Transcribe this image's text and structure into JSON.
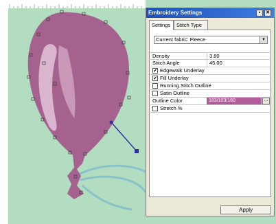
{
  "panel": {
    "title": "Embroidery Settings",
    "pin_glyph": "▪",
    "close_glyph": "✕",
    "tabs": [
      {
        "label": "Settings"
      },
      {
        "label": "Stitch Type"
      }
    ],
    "fabric": {
      "value": "Current fabric: Fleece",
      "arrow": "▼"
    },
    "properties": [
      {
        "label": "Density",
        "value": "3.80"
      },
      {
        "label": "Stitch Angle",
        "value": "45.00"
      }
    ],
    "checkboxes": [
      {
        "label": "Edgewalk Underlay",
        "checked": true
      },
      {
        "label": "Fill Underlay",
        "checked": true
      },
      {
        "label": "Running Stitch Outline",
        "checked": false
      },
      {
        "label": "Satin Outline",
        "checked": false
      }
    ],
    "outline_color": {
      "label": "Outline Color",
      "value": "183/103/160",
      "button": "..."
    },
    "stretch": {
      "label": "Stretch %",
      "checked": false
    },
    "apply_label": "Apply",
    "check_mark": "✔"
  },
  "colors": {
    "canvas_bg": "#b2ddc1",
    "balloon": "#a5628f",
    "highlight": "#d9b6cd",
    "handle": "#2a2f9c",
    "string": "#7eb9c9"
  }
}
